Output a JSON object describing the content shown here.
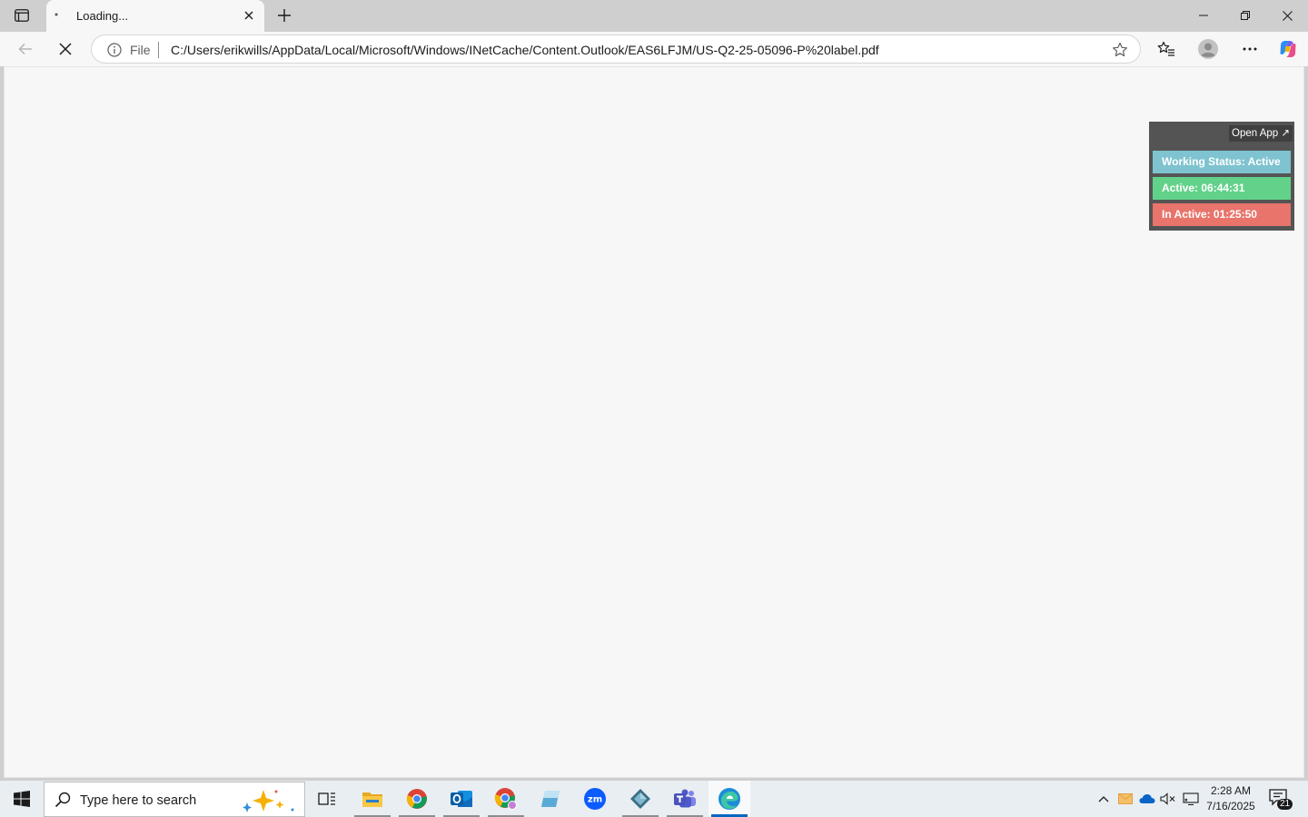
{
  "browser": {
    "tab": {
      "title": "Loading..."
    },
    "address_bar": {
      "scheme_label": "File",
      "url": "C:/Users/erikwills/AppData/Local/Microsoft/Windows/INetCache/Content.Outlook/EAS6LFJM/US-Q2-25-05096-P%20label.pdf"
    }
  },
  "tracker_widget": {
    "open_app_label": "Open App ↗",
    "working_status": "Working Status: Active",
    "active_time": "Active: 06:44:31",
    "inactive_time": "In Active: 01:25:50",
    "colors": {
      "status": "#7ec3cf",
      "active": "#62d28a",
      "inactive": "#e8746b"
    }
  },
  "taskbar": {
    "search_placeholder": "Type here to search",
    "apps": [
      "task-view",
      "file-explorer",
      "chrome",
      "outlook",
      "chrome-profile",
      "app-blue",
      "zoom",
      "app-diamond",
      "teams",
      "edge"
    ],
    "clock": {
      "time": "2:28 AM",
      "date": "7/16/2025"
    },
    "notification_count": "21"
  }
}
